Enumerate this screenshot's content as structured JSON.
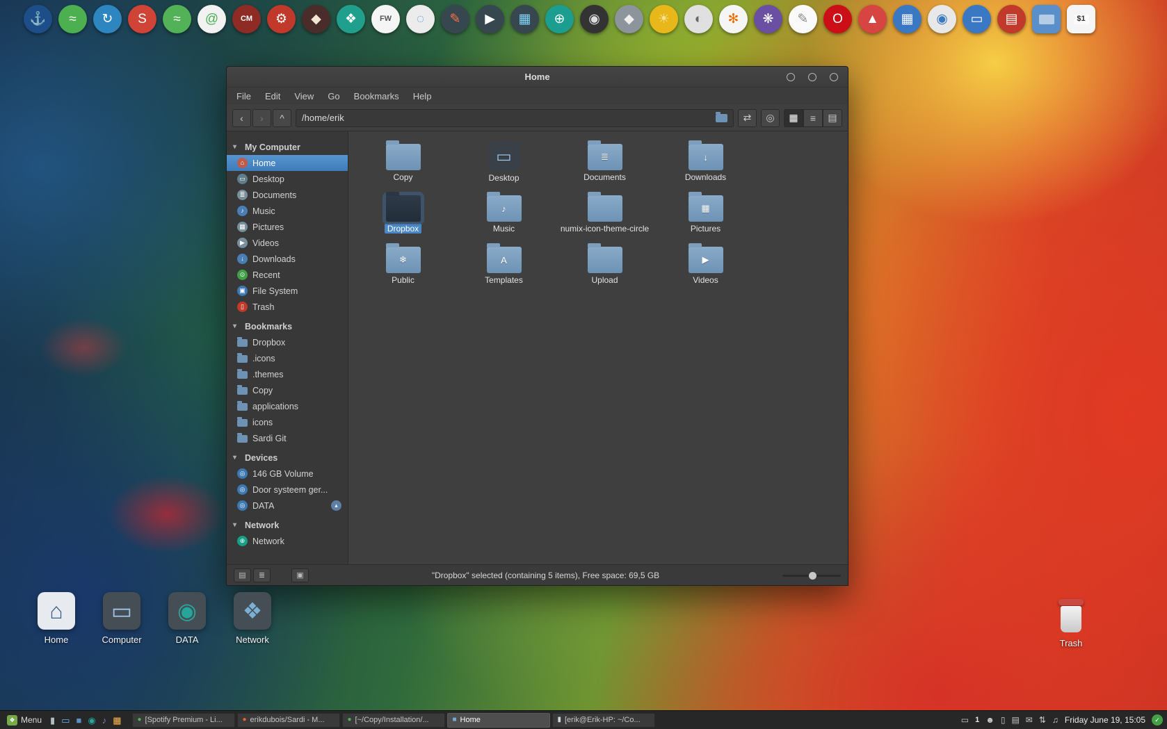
{
  "icons": {
    "disclosure": "▾",
    "eject": "▴",
    "back": "‹",
    "forward": "›",
    "up": "^",
    "edit_location": "⇄",
    "search": "◎",
    "icon_view": "▦",
    "list_view": "≡",
    "compact_view": "▤",
    "places_btn": "▤",
    "tree_btn": "≣",
    "extra_btn": "▣",
    "menu_glyph": "❖",
    "shield_check": "✓"
  },
  "dock": {
    "items": [
      {
        "name": "anchor-icon",
        "glyph": "⚓",
        "bg": "#1d4e89",
        "fg": "#ffffff"
      },
      {
        "name": "system-monitor-icon",
        "glyph": "≈",
        "bg": "#4caf50",
        "fg": "#ffffff"
      },
      {
        "name": "update-manager-icon",
        "glyph": "↻",
        "bg": "#2e86c1",
        "fg": "#ffffff"
      },
      {
        "name": "skype-icon",
        "glyph": "S",
        "bg": "#d04437",
        "fg": "#ffffff"
      },
      {
        "name": "spotify-icon",
        "glyph": "≈",
        "bg": "#53b158",
        "fg": "#ffffff"
      },
      {
        "name": "email-icon",
        "glyph": "@",
        "bg": "#f2f2f2",
        "fg": "#4caf50"
      },
      {
        "name": "cm-app-icon",
        "glyph": "CM",
        "bg": "#8e2b25",
        "fg": "#ffffff",
        "cls": "txt"
      },
      {
        "name": "tools-icon",
        "glyph": "⚙",
        "bg": "#c0392b",
        "fg": "#ffffff"
      },
      {
        "name": "inkscape-icon",
        "glyph": "◆",
        "bg": "#4a2c2a",
        "fg": "#f0e6d2"
      },
      {
        "name": "shapes-app-icon",
        "glyph": "❖",
        "bg": "#20a08c",
        "fg": "#ffffff"
      },
      {
        "name": "framework-icon",
        "glyph": "FW",
        "bg": "#f5f5f5",
        "fg": "#555555",
        "cls": "txt"
      },
      {
        "name": "selection-tool-icon",
        "glyph": "◌",
        "bg": "#ececec",
        "fg": "#4a90d9"
      },
      {
        "name": "pencil-icon",
        "glyph": "✎",
        "bg": "#37474f",
        "fg": "#ff7043"
      },
      {
        "name": "video-app-icon",
        "glyph": "▶",
        "bg": "#37474f",
        "fg": "#ffffff"
      },
      {
        "name": "image-viewer-icon",
        "glyph": "▦",
        "bg": "#37474f",
        "fg": "#81d4fa"
      },
      {
        "name": "web-browser-icon",
        "glyph": "⊕",
        "bg": "#1b9e8f",
        "fg": "#ffffff"
      },
      {
        "name": "disc-burner-icon",
        "glyph": "◉",
        "bg": "#333333",
        "fg": "#dddddd"
      },
      {
        "name": "shield-app-icon",
        "glyph": "◆",
        "bg": "#8d959c",
        "fg": "#eeeeee"
      },
      {
        "name": "yellow-app-icon",
        "glyph": "☀",
        "bg": "#e8b71a",
        "fg": "#f7e39a"
      },
      {
        "name": "contrast-app-icon",
        "glyph": "◐",
        "bg": "#e0e0e0",
        "fg": "#666666"
      },
      {
        "name": "flower-app-icon",
        "glyph": "✻",
        "bg": "#f5f5f5",
        "fg": "#ef6c00"
      },
      {
        "name": "purple-app-icon",
        "glyph": "❋",
        "bg": "#6a4fa3",
        "fg": "#ffffff"
      },
      {
        "name": "sketch-app-icon",
        "glyph": "✎",
        "bg": "#fafafa",
        "fg": "#888888"
      },
      {
        "name": "opera-icon",
        "glyph": "O",
        "bg": "#cc0f16",
        "fg": "#ffffff"
      },
      {
        "name": "triangle-app-icon",
        "glyph": "▲",
        "bg": "#d64541",
        "fg": "#ffffff"
      },
      {
        "name": "grid-app-icon",
        "glyph": "▦",
        "bg": "#3b78c3",
        "fg": "#ffffff"
      },
      {
        "name": "chromium-icon",
        "glyph": "◉",
        "bg": "#e8e8e8",
        "fg": "#3b78c3"
      },
      {
        "name": "display-app-icon",
        "glyph": "▭",
        "bg": "#3b78c3",
        "fg": "#ffffff"
      },
      {
        "name": "printer-icon",
        "glyph": "▤",
        "bg": "#c0392b",
        "fg": "#ffffff"
      },
      {
        "name": "files-folder-icon",
        "glyph": "",
        "bg": "#5b8fc9",
        "fg": "#ffffff",
        "cls": "square"
      },
      {
        "name": "dollar-app-icon",
        "glyph": "$1",
        "bg": "#f5f5f5",
        "fg": "#333333",
        "cls": "square txt"
      }
    ]
  },
  "window": {
    "title": "Home",
    "menu": [
      {
        "name": "menu-file",
        "label": "File"
      },
      {
        "name": "menu-edit",
        "label": "Edit"
      },
      {
        "name": "menu-view",
        "label": "View"
      },
      {
        "name": "menu-go",
        "label": "Go"
      },
      {
        "name": "menu-bookmarks",
        "label": "Bookmarks"
      },
      {
        "name": "menu-help",
        "label": "Help"
      }
    ],
    "toolbar": {
      "path": "/home/erik"
    },
    "sidebar": {
      "rows": [
        {
          "cls": "header",
          "name": "sidebar-section-my-computer",
          "label": "My Computer"
        },
        {
          "cls": "item selected",
          "name": "sidebar-item-home",
          "label": "Home",
          "glyph": "⌂",
          "bg": "#bf5b4b"
        },
        {
          "cls": "item",
          "name": "sidebar-item-desktop",
          "label": "Desktop",
          "glyph": "▭",
          "bg": "#607d8b"
        },
        {
          "cls": "item",
          "name": "sidebar-item-documents",
          "label": "Documents",
          "glyph": "≣",
          "bg": "#78909c"
        },
        {
          "cls": "item",
          "name": "sidebar-item-music",
          "label": "Music",
          "glyph": "♪",
          "bg": "#4a7fb5"
        },
        {
          "cls": "item",
          "name": "sidebar-item-pictures",
          "label": "Pictures",
          "glyph": "▦",
          "bg": "#78909c"
        },
        {
          "cls": "item",
          "name": "sidebar-item-videos",
          "label": "Videos",
          "glyph": "▶",
          "bg": "#78909c"
        },
        {
          "cls": "item",
          "name": "sidebar-item-downloads",
          "label": "Downloads",
          "glyph": "↓",
          "bg": "#4a7fb5"
        },
        {
          "cls": "item",
          "name": "sidebar-item-recent",
          "label": "Recent",
          "glyph": "⊙",
          "bg": "#43a047"
        },
        {
          "cls": "item",
          "name": "sidebar-item-file-system",
          "label": "File System",
          "glyph": "▣",
          "bg": "#3d78b3"
        },
        {
          "cls": "item",
          "name": "sidebar-item-trash",
          "label": "Trash",
          "glyph": "▯",
          "bg": "#c0392b"
        },
        {
          "cls": "header",
          "name": "sidebar-section-bookmarks",
          "label": "Bookmarks"
        },
        {
          "cls": "item folder",
          "name": "sidebar-item-dropbox",
          "label": "Dropbox"
        },
        {
          "cls": "item folder",
          "name": "sidebar-item-dot-icons",
          "label": ".icons"
        },
        {
          "cls": "item folder",
          "name": "sidebar-item-dot-themes",
          "label": ".themes"
        },
        {
          "cls": "item folder",
          "name": "sidebar-item-copy",
          "label": "Copy"
        },
        {
          "cls": "item folder",
          "name": "sidebar-item-applications",
          "label": "applications"
        },
        {
          "cls": "item folder",
          "name": "sidebar-item-icons",
          "label": "icons"
        },
        {
          "cls": "item folder",
          "name": "sidebar-item-sardi-git",
          "label": "Sardi Git"
        },
        {
          "cls": "header",
          "name": "sidebar-section-devices",
          "label": "Devices"
        },
        {
          "cls": "item",
          "name": "sidebar-item-146gb-volume",
          "label": "146 GB Volume",
          "glyph": "◎",
          "bg": "#3d78b3"
        },
        {
          "cls": "item",
          "name": "sidebar-item-door-systeem",
          "label": "Door systeem ger...",
          "glyph": "◎",
          "bg": "#3d78b3"
        },
        {
          "cls": "item eject",
          "name": "sidebar-item-data",
          "label": "DATA",
          "glyph": "◎",
          "bg": "#3d78b3"
        },
        {
          "cls": "header",
          "name": "sidebar-section-network",
          "label": "Network"
        },
        {
          "cls": "item",
          "name": "sidebar-item-network",
          "label": "Network",
          "glyph": "⊕",
          "bg": "#16a085"
        }
      ]
    },
    "files": [
      {
        "name": "file-copy",
        "label": "Copy",
        "emblem": ""
      },
      {
        "cls": "desktop",
        "name": "file-desktop",
        "label": "Desktop",
        "emblem": "▭",
        "efg": "#9fc4e8"
      },
      {
        "name": "file-documents",
        "label": "Documents",
        "emblem": "≣"
      },
      {
        "name": "file-downloads",
        "label": "Downloads",
        "emblem": "↓"
      },
      {
        "cls": "dark selected",
        "name": "file-dropbox",
        "label": "Dropbox",
        "emblem": ""
      },
      {
        "name": "file-music",
        "label": "Music",
        "emblem": "♪"
      },
      {
        "name": "file-numix-icon-theme-circle",
        "label": "numix-icon-theme-circle",
        "emblem": ""
      },
      {
        "name": "file-pictures",
        "label": "Pictures",
        "emblem": "▦"
      },
      {
        "name": "file-public",
        "label": "Public",
        "emblem": "❄"
      },
      {
        "name": "file-templates",
        "label": "Templates",
        "emblem": "A"
      },
      {
        "name": "file-upload",
        "label": "Upload",
        "emblem": ""
      },
      {
        "name": "file-videos",
        "label": "Videos",
        "emblem": "▶"
      }
    ],
    "status": {
      "text": "\"Dropbox\" selected (containing 5 items), Free space: 69,5 GB"
    }
  },
  "desktop": {
    "icons": [
      {
        "name": "desktop-icon-home",
        "label": "Home",
        "glyph": "⌂",
        "bg": "#e7eaee",
        "fg": "#3a5f8a"
      },
      {
        "name": "desktop-icon-computer",
        "label": "Computer",
        "glyph": "▭",
        "bg": "#454d55",
        "fg": "#9fc4e8"
      },
      {
        "name": "desktop-icon-data",
        "label": "DATA",
        "glyph": "◉",
        "bg": "#454d55",
        "fg": "#26a69a"
      },
      {
        "name": "desktop-icon-network",
        "label": "Network",
        "glyph": "❖",
        "bg": "#454d55",
        "fg": "#7ab0d4"
      }
    ],
    "trash_label": "Trash"
  },
  "taskbar": {
    "menu_label": "Menu",
    "launchers": [
      {
        "name": "launcher-terminal-icon",
        "glyph": "▮",
        "fg": "#b0bec5"
      },
      {
        "name": "launcher-display-icon",
        "glyph": "▭",
        "fg": "#64b5f6"
      },
      {
        "name": "launcher-files-icon",
        "glyph": "■",
        "fg": "#5b8fc9"
      },
      {
        "name": "launcher-globe-icon",
        "glyph": "◉",
        "fg": "#26a69a"
      },
      {
        "name": "launcher-music-icon",
        "glyph": "♪",
        "fg": "#9575cd"
      },
      {
        "name": "launcher-photos-icon",
        "glyph": "▦",
        "fg": "#ffb74d"
      }
    ],
    "windows": [
      {
        "name": "taskbar-window-spotify",
        "icon": "●",
        "iconColor": "#53b158",
        "label": "[Spotify Premium - Li..."
      },
      {
        "name": "taskbar-window-browser",
        "icon": "●",
        "iconColor": "#e8622d",
        "label": "erikdubois/Sardi - M..."
      },
      {
        "name": "taskbar-window-files-copy",
        "icon": "●",
        "iconColor": "#53b158",
        "label": "[~/Copy/Installation/..."
      },
      {
        "cls": "active",
        "name": "taskbar-window-home",
        "icon": "■",
        "iconColor": "#7fa8d0",
        "label": "Home"
      },
      {
        "name": "taskbar-window-terminal",
        "icon": "▮",
        "iconColor": "#cfd8dc",
        "label": "[erik@Erik-HP: ~/Co..."
      }
    ],
    "tray_icons": [
      {
        "name": "tray-display-icon",
        "glyph": "▭"
      },
      {
        "cls": "count",
        "name": "tray-count",
        "glyph": "1"
      },
      {
        "name": "tray-user-icon",
        "glyph": "☻"
      },
      {
        "name": "tray-tablet-icon",
        "glyph": "▯"
      },
      {
        "name": "tray-keyboard-icon",
        "glyph": "▤"
      },
      {
        "name": "tray-mail-icon",
        "glyph": "✉"
      },
      {
        "name": "tray-sync-icon",
        "glyph": "⇅"
      },
      {
        "name": "tray-volume-icon",
        "glyph": "♫"
      }
    ],
    "clock": "Friday June 19, 15:05"
  }
}
